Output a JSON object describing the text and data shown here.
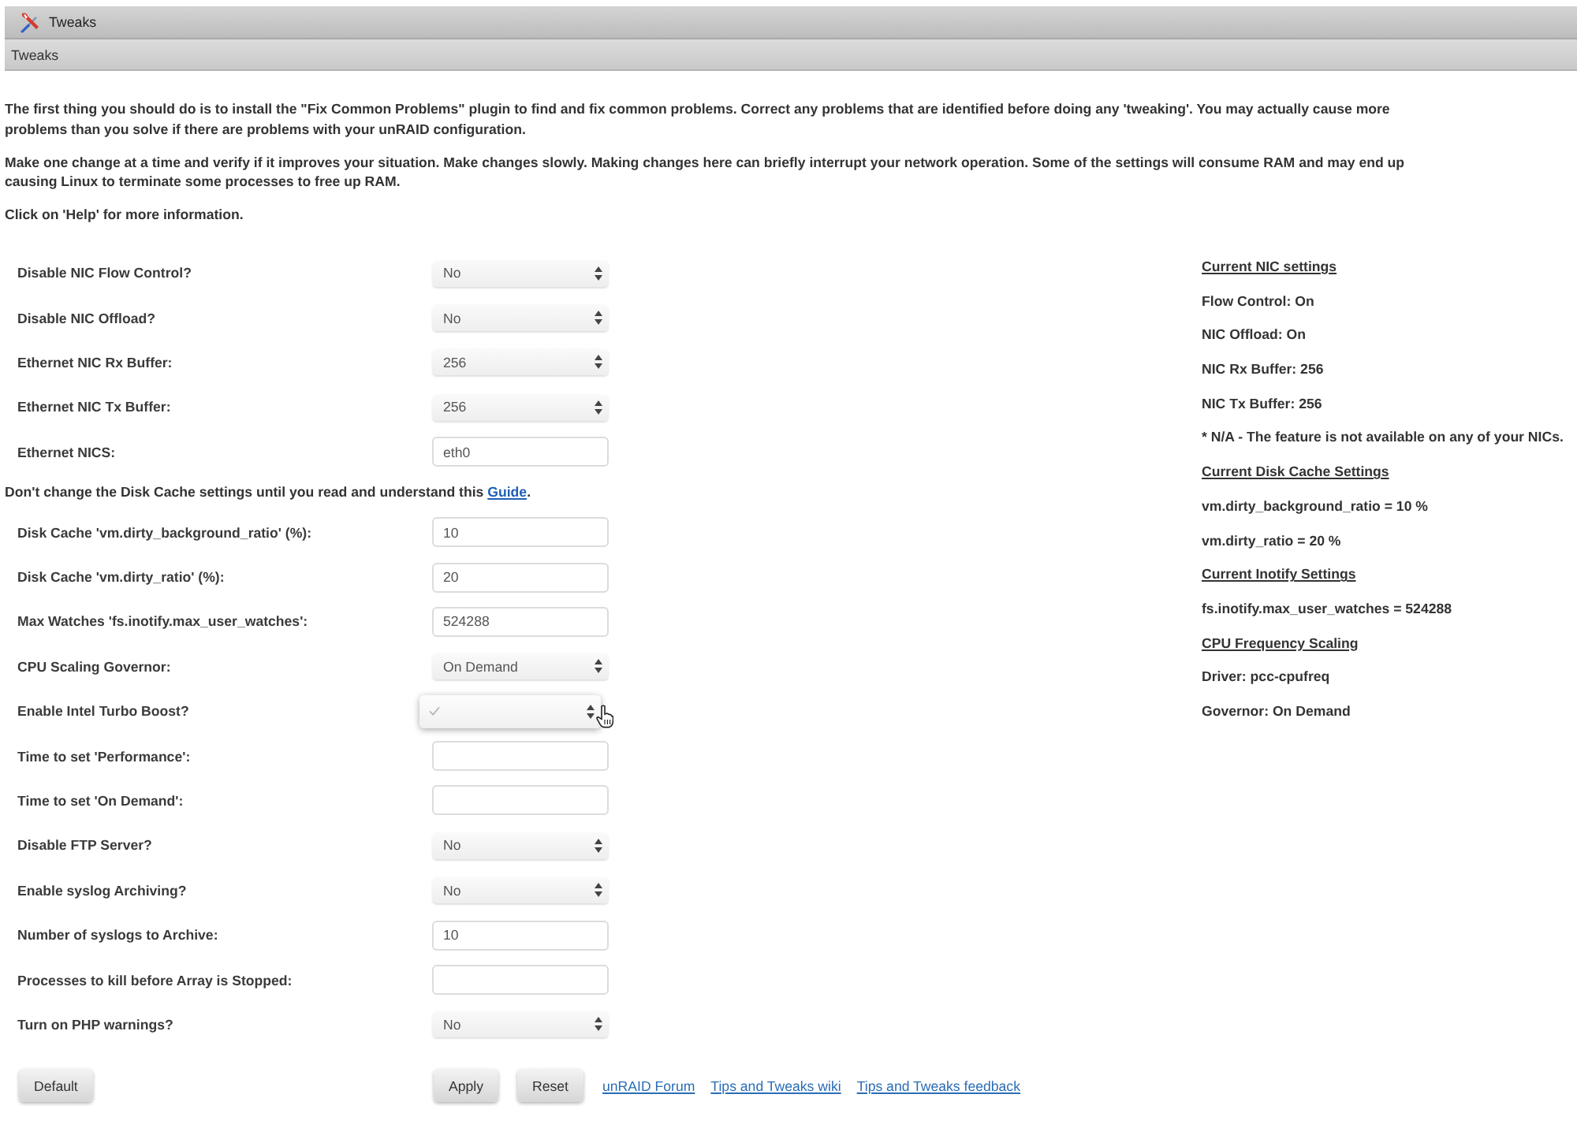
{
  "window": {
    "title": "Tweaks"
  },
  "section": {
    "title": "Tweaks"
  },
  "intro": [
    "The first thing you should do is to install the \"Fix Common Problems\" plugin to find and fix common problems. Correct any problems that are identified before doing any 'tweaking'. You may actually cause more problems than you solve if there are problems with your unRAID configuration.",
    "Make one change at a time and verify if it improves your situation. Make changes slowly. Making changes here can briefly interrupt your network operation. Some of the settings will consume RAM and may end up causing Linux to terminate some processes to free up RAM.",
    "Click on 'Help' for more information."
  ],
  "settings": [
    {
      "kind": "select",
      "label": "Disable NIC Flow Control?",
      "value": "No",
      "open": false
    },
    {
      "kind": "select",
      "label": "Disable NIC Offload?",
      "value": "No",
      "open": false
    },
    {
      "kind": "select",
      "label": "Ethernet NIC Rx Buffer:",
      "value": "256",
      "open": false
    },
    {
      "kind": "select",
      "label": "Ethernet NIC Tx Buffer:",
      "value": "256",
      "open": false
    },
    {
      "kind": "input",
      "label": "Ethernet NICS:",
      "value": "eth0"
    },
    {
      "kind": "note",
      "text": "Don't change the Disk Cache settings until you read and understand this ",
      "link": "Guide",
      "suffix": "."
    },
    {
      "kind": "input",
      "label": "Disk Cache 'vm.dirty_background_ratio' (%):",
      "value": "10"
    },
    {
      "kind": "input",
      "label": "Disk Cache 'vm.dirty_ratio' (%):",
      "value": "20"
    },
    {
      "kind": "input",
      "label": "Max Watches 'fs.inotify.max_user_watches':",
      "value": "524288"
    },
    {
      "kind": "select",
      "label": "CPU Scaling Governor:",
      "value": "On Demand",
      "open": false
    },
    {
      "kind": "select",
      "label": "Enable Intel Turbo Boost?",
      "open": true
    },
    {
      "kind": "input",
      "label": "Time to set 'Performance':"
    },
    {
      "kind": "input",
      "label": "Time to set 'On Demand':"
    },
    {
      "kind": "select",
      "label": "Disable FTP Server?",
      "value": "No",
      "open": false
    },
    {
      "kind": "select",
      "label": "Enable syslog Archiving?",
      "value": "No",
      "open": false
    },
    {
      "kind": "input",
      "label": "Number of syslogs to Archive:",
      "value": "10"
    },
    {
      "kind": "input",
      "label": "Processes to kill before Array is Stopped:"
    },
    {
      "kind": "select",
      "label": "Turn on PHP warnings?",
      "value": "No",
      "open": false
    }
  ],
  "buttons": {
    "default": "Default",
    "actions": [
      "Apply",
      "Reset"
    ],
    "links": [
      "unRAID Forum",
      "Tips and Tweaks wiki",
      "Tips and Tweaks feedback"
    ]
  },
  "status": [
    {
      "kind": "heading",
      "text": "Current NIC settings"
    },
    {
      "kind": "text",
      "text": "Flow Control: On"
    },
    {
      "kind": "text",
      "text": "NIC Offload: On"
    },
    {
      "kind": "text",
      "text": "NIC Rx Buffer: 256"
    },
    {
      "kind": "text",
      "text": "NIC Tx Buffer: 256"
    },
    {
      "kind": "text",
      "text": "* N/A - The feature is not available on any of your NICs."
    },
    {
      "kind": "heading",
      "text": "Current Disk Cache Settings"
    },
    {
      "kind": "text",
      "text": "vm.dirty_background_ratio = 10 %"
    },
    {
      "kind": "text",
      "text": "vm.dirty_ratio = 20 %"
    },
    {
      "kind": "heading",
      "text": "Current Inotify Settings"
    },
    {
      "kind": "text",
      "text": "fs.inotify.max_user_watches = 524288"
    },
    {
      "kind": "heading",
      "text": "CPU Frequency Scaling"
    },
    {
      "kind": "text",
      "text": "Driver: pcc-cpufreq"
    },
    {
      "kind": "text",
      "text": "Governor: On Demand"
    }
  ]
}
